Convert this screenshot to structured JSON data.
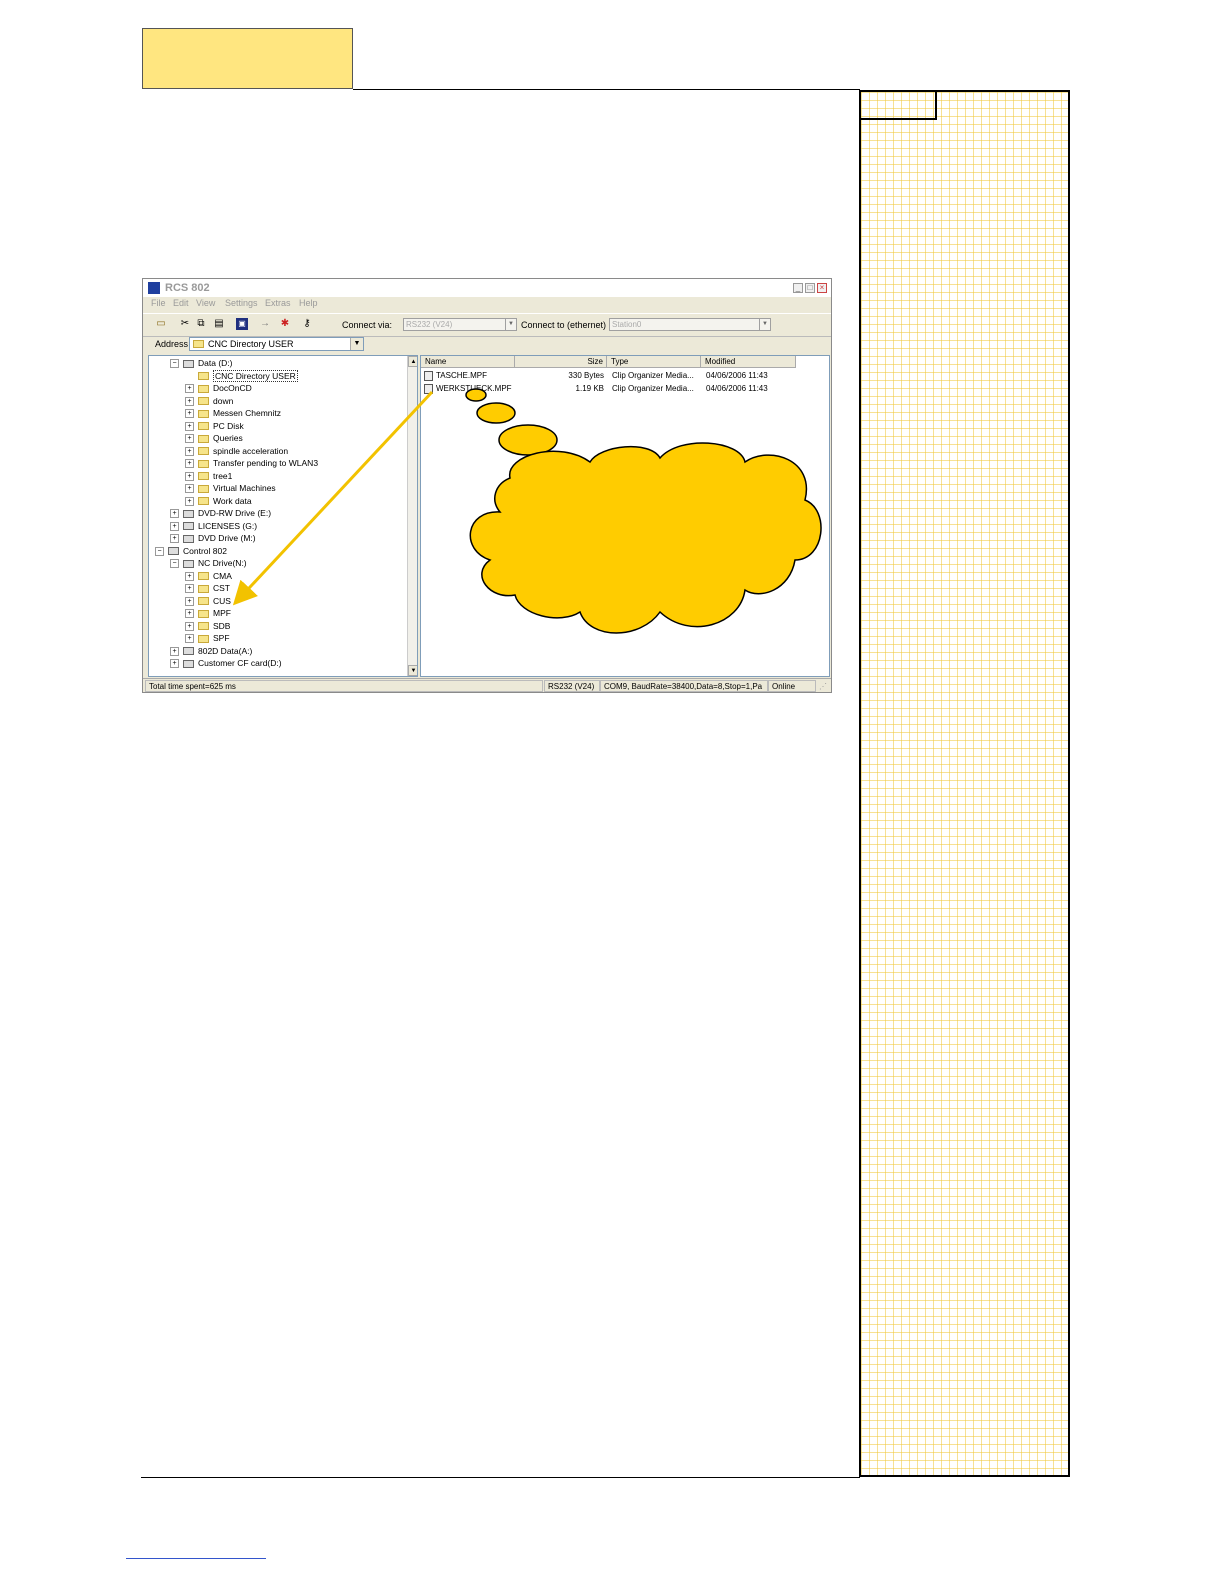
{
  "window": {
    "title": "RCS 802",
    "controls": {
      "minimize": "_",
      "maximize": "□",
      "close": "×"
    }
  },
  "menubar": [
    "File",
    "Edit",
    "View",
    "Settings",
    "Extras",
    "Help"
  ],
  "toolbar": {
    "icons": [
      "open-folder-icon",
      "cut-icon",
      "copy-icon",
      "paste-icon",
      "save-icon",
      "connect-icon",
      "disconnect-icon",
      "key-icon"
    ],
    "connect_via_label": "Connect via:",
    "connect_via_value": "RS232 (V24)",
    "connect_to_label": "Connect to (ethernet) :",
    "connect_to_value": "Station0"
  },
  "address": {
    "label": "Address",
    "value": "CNC Directory USER"
  },
  "tree": [
    {
      "label": "Data (D:)",
      "level": 1,
      "expander": "−",
      "icon": "drive"
    },
    {
      "label": "CNC Directory USER",
      "level": 2,
      "expander": "",
      "icon": "folder-open",
      "selected": true
    },
    {
      "label": "DocOnCD",
      "level": 2,
      "expander": "+",
      "icon": "folder"
    },
    {
      "label": "down",
      "level": 2,
      "expander": "+",
      "icon": "folder"
    },
    {
      "label": "Messen Chemnitz",
      "level": 2,
      "expander": "+",
      "icon": "folder"
    },
    {
      "label": "PC Disk",
      "level": 2,
      "expander": "+",
      "icon": "folder"
    },
    {
      "label": "Queries",
      "level": 2,
      "expander": "+",
      "icon": "folder"
    },
    {
      "label": "spindle acceleration",
      "level": 2,
      "expander": "+",
      "icon": "folder"
    },
    {
      "label": "Transfer pending to WLAN3",
      "level": 2,
      "expander": "+",
      "icon": "folder"
    },
    {
      "label": "tree1",
      "level": 2,
      "expander": "+",
      "icon": "folder"
    },
    {
      "label": "Virtual Machines",
      "level": 2,
      "expander": "+",
      "icon": "folder"
    },
    {
      "label": "Work data",
      "level": 2,
      "expander": "+",
      "icon": "folder"
    },
    {
      "label": "DVD-RW Drive (E:)",
      "level": 1,
      "expander": "+",
      "icon": "drive"
    },
    {
      "label": "LICENSES (G:)",
      "level": 1,
      "expander": "+",
      "icon": "drive"
    },
    {
      "label": "DVD Drive (M:)",
      "level": 1,
      "expander": "+",
      "icon": "drive"
    },
    {
      "label": "Control 802",
      "level": 0,
      "expander": "−",
      "icon": "drive"
    },
    {
      "label": "NC Drive(N:)",
      "level": 1,
      "expander": "−",
      "icon": "drive"
    },
    {
      "label": "CMA",
      "level": 2,
      "expander": "+",
      "icon": "folder"
    },
    {
      "label": "CST",
      "level": 2,
      "expander": "+",
      "icon": "folder"
    },
    {
      "label": "CUS",
      "level": 2,
      "expander": "+",
      "icon": "folder"
    },
    {
      "label": "MPF",
      "level": 2,
      "expander": "+",
      "icon": "folder"
    },
    {
      "label": "SDB",
      "level": 2,
      "expander": "+",
      "icon": "folder"
    },
    {
      "label": "SPF",
      "level": 2,
      "expander": "+",
      "icon": "folder"
    },
    {
      "label": "802D Data(A:)",
      "level": 1,
      "expander": "+",
      "icon": "drive"
    },
    {
      "label": "Customer CF card(D:)",
      "level": 1,
      "expander": "+",
      "icon": "drive"
    }
  ],
  "list": {
    "columns": [
      "Name",
      "Size",
      "Type",
      "Modified"
    ],
    "rows": [
      {
        "name": "TASCHE.MPF",
        "size": "330 Bytes",
        "type": "Clip Organizer Media...",
        "modified": "04/06/2006  11:43"
      },
      {
        "name": "WERKSTUECK.MPF",
        "size": "1.19 KB",
        "type": "Clip Organizer Media...",
        "modified": "04/06/2006  11:43"
      }
    ]
  },
  "statusbar": {
    "time": "Total time spent=625 ms",
    "mode": "RS232 (V24)",
    "port": "COM9, BaudRate=38400,Data=8,Stop=1,Pa",
    "state": "Online"
  },
  "colors": {
    "callout_fill": "#ffcc00",
    "arrow": "#f2c200",
    "tab_fill": "#ffe680",
    "grid_line": "#f0c83c"
  }
}
